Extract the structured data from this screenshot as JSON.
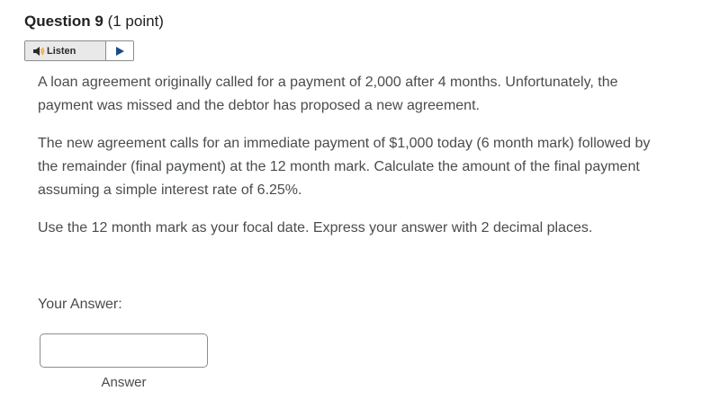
{
  "question": {
    "title": "Question 9",
    "points": "(1 point)"
  },
  "listen": {
    "label": "Listen",
    "speaker_icon": "speaker-icon",
    "play_icon": "play-icon"
  },
  "body": {
    "paragraph1": "A loan agreement originally called for a payment of 2,000 after 4 months. Unfortunately, the payment was missed and the debtor has proposed a new agreement.",
    "paragraph2": "The new agreement calls for an immediate payment of $1,000 today (6 month mark) followed by the remainder (final payment) at the 12 month mark. Calculate the amount of the final payment assuming a simple interest rate of 6.25%.",
    "paragraph3": "Use the 12 month mark as your focal date. Express your answer with 2 decimal places."
  },
  "answer": {
    "label": "Your Answer:",
    "value": "",
    "caption": "Answer"
  }
}
